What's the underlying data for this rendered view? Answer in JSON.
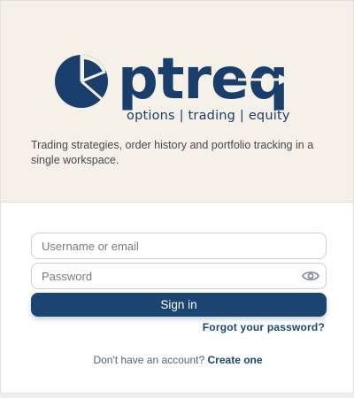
{
  "brand": {
    "wordmark": "ptreq",
    "tagline_parts": [
      "options",
      "trading",
      "equity"
    ],
    "separator": "|",
    "description": "Trading strategies, order history and portfolio tracking in a single workspace.",
    "color": "#1a3e6b"
  },
  "form": {
    "username_placeholder": "Username or email",
    "username_value": "",
    "password_placeholder": "Password",
    "password_value": "",
    "signin_label": "Sign in",
    "forgot_label": "Forgot your password?",
    "signup_prompt": "Don't have an account?",
    "signup_link": "Create one"
  },
  "colors": {
    "hero_bg": "#f5f0e8",
    "primary": "#1a4570"
  },
  "icons": {
    "logo": "pie-chart-logo-icon",
    "password_toggle": "eye-icon"
  }
}
